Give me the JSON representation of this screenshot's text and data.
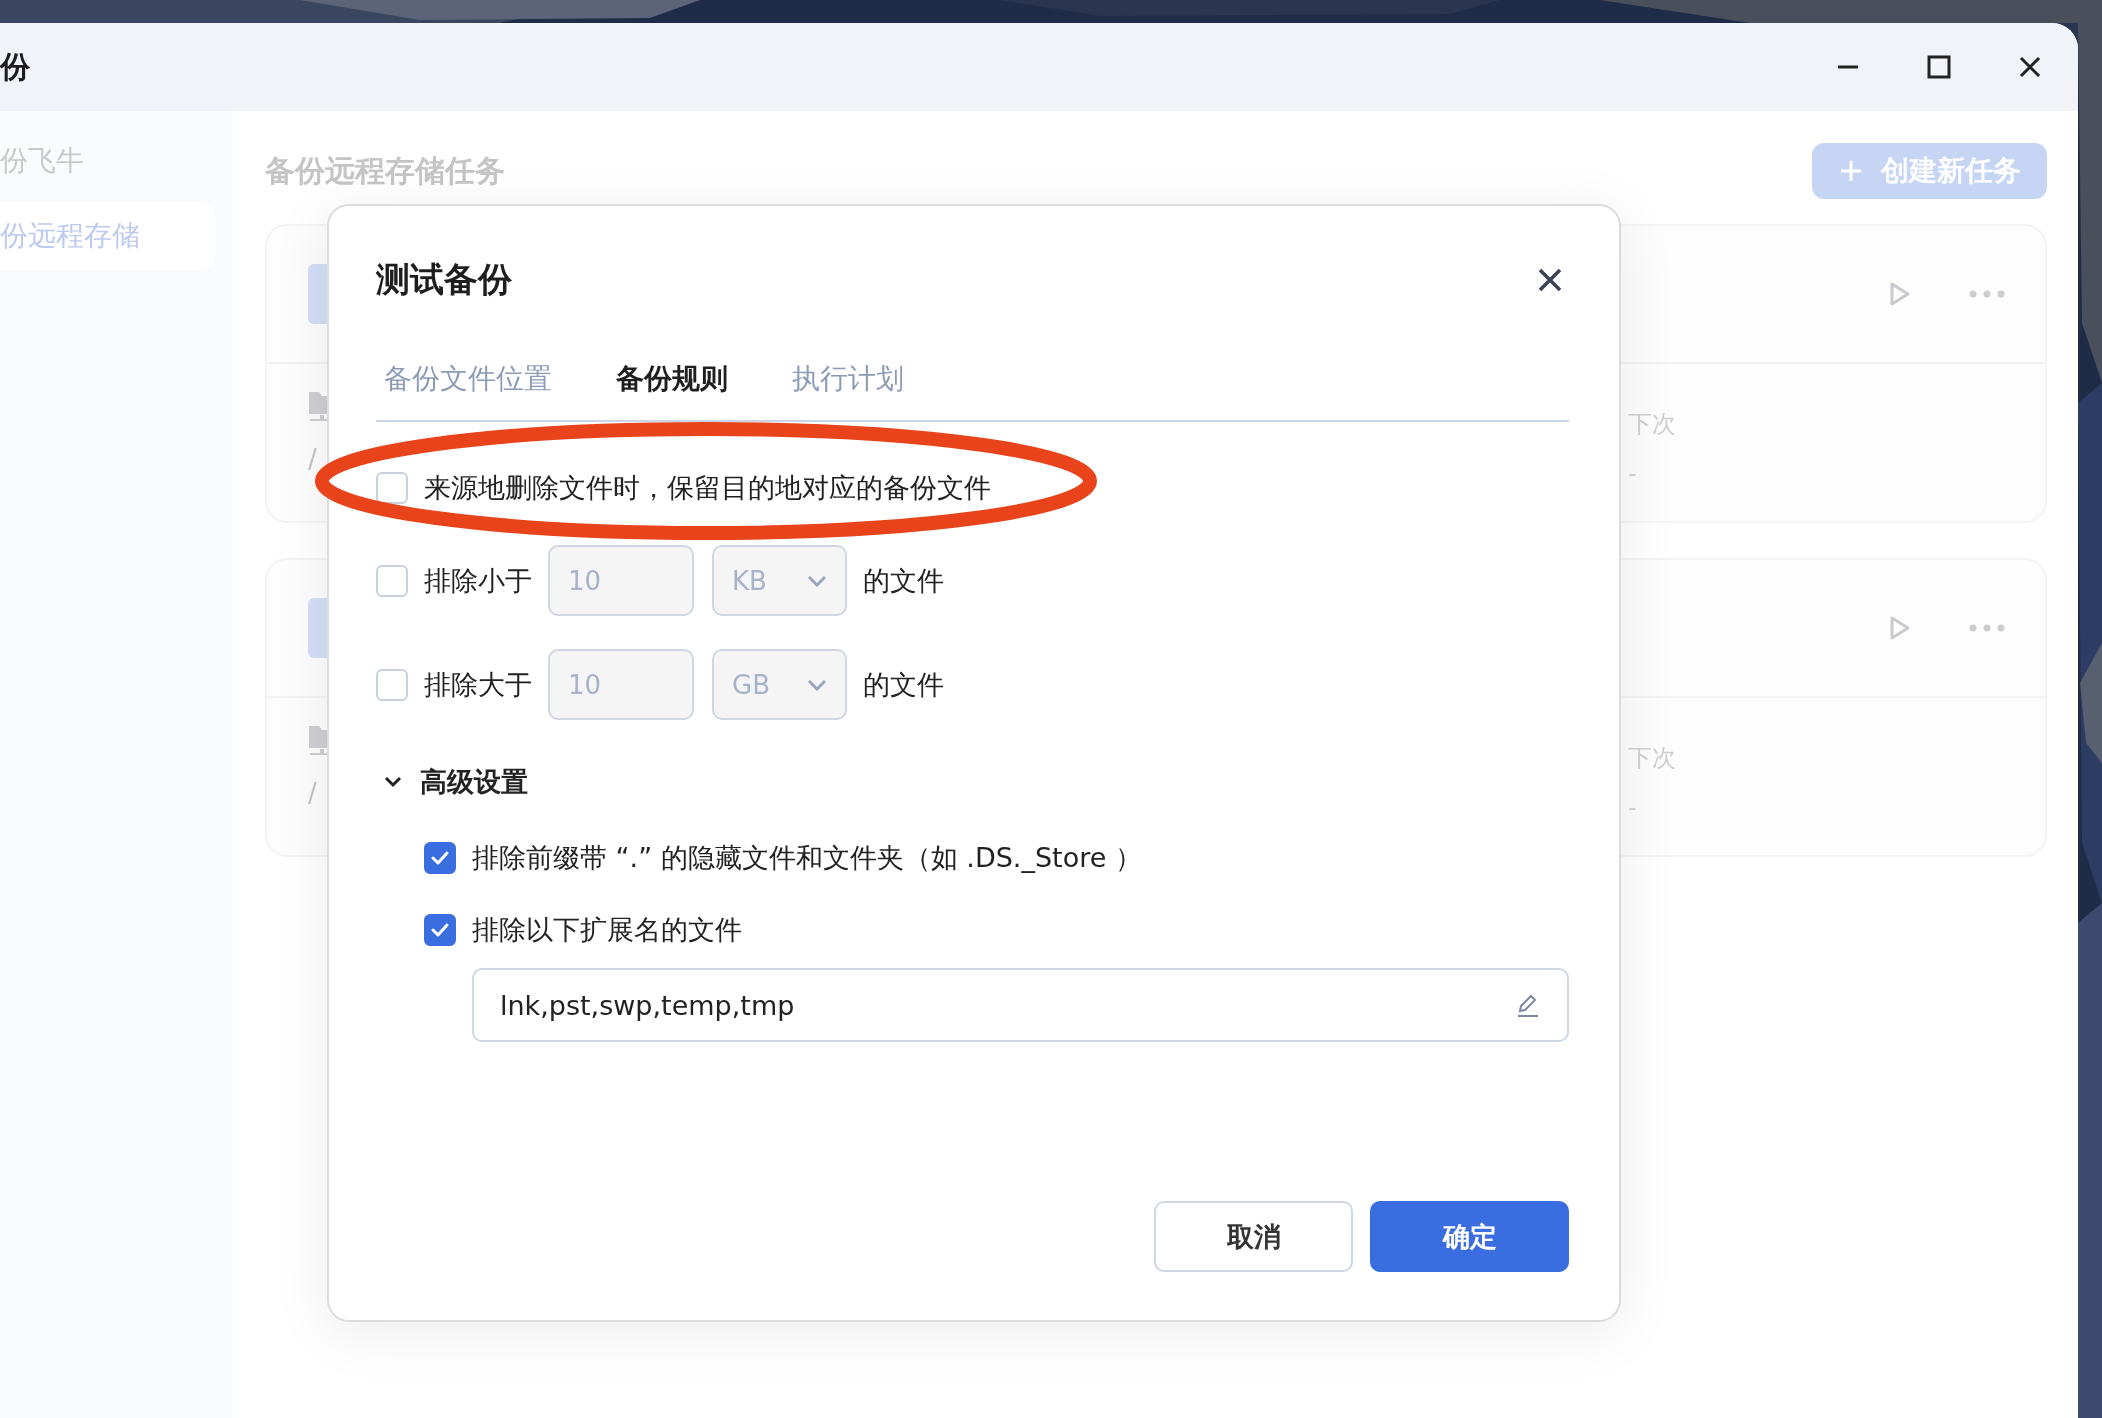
{
  "window": {
    "title": "份"
  },
  "sidebar": {
    "items": [
      {
        "label": "份飞牛",
        "selected": false
      },
      {
        "label": "份远程存储",
        "selected": true
      }
    ]
  },
  "main": {
    "heading": "备份远程存储任务",
    "create_button": "创建新任务",
    "tasks": [
      {
        "path": "/",
        "next_label": "下次",
        "next_value": "-"
      },
      {
        "path": "/",
        "next_label": "下次",
        "next_value": "-"
      }
    ]
  },
  "dialog": {
    "title": "测试备份",
    "tabs": [
      {
        "label": "备份文件位置",
        "selected": false
      },
      {
        "label": "备份规则",
        "selected": true
      },
      {
        "label": "执行计划",
        "selected": false
      }
    ],
    "rules": [
      {
        "kind": "plain",
        "label": "来源地删除文件时，保留目的地对应的备份文件",
        "checked": false,
        "circled": true
      },
      {
        "kind": "size",
        "label": "排除小于",
        "checked": false,
        "value": "10",
        "unit": "KB",
        "suffix": "的文件",
        "circled": false
      },
      {
        "kind": "size",
        "label": "排除大于",
        "checked": false,
        "value": "10",
        "unit": "GB",
        "suffix": "的文件",
        "circled": false
      }
    ],
    "advanced": {
      "label": "高级设置",
      "expanded": true,
      "options": [
        {
          "label": "排除前缀带 “.” 的隐藏文件和文件夹（如 .DS._Store ）",
          "checked": true
        },
        {
          "label": "排除以下扩展名的文件",
          "checked": true,
          "field": {
            "value": "lnk,pst,swp,temp,tmp"
          }
        }
      ]
    },
    "buttons": [
      {
        "label": "取消",
        "kind": "secondary"
      },
      {
        "label": "确定",
        "kind": "primary"
      }
    ]
  }
}
